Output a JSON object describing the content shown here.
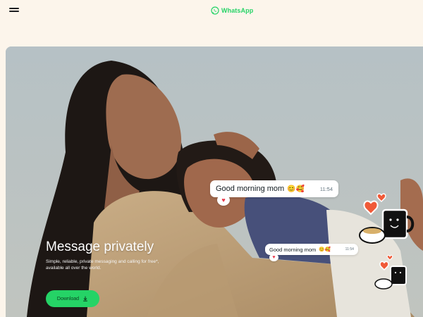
{
  "header": {
    "menu_icon": "hamburger-menu-icon",
    "logo_icon": "whatsapp-logo-icon",
    "logo_text": "WhatsApp"
  },
  "hero": {
    "headline": "Message privately",
    "subtext": "Simple, reliable, private messaging and calling for free*, available all over the world.",
    "download_label": "Download",
    "download_icon": "download-arrow-icon",
    "chat_bubble_1": {
      "text": "Good morning mom",
      "emoji": "😊🥰",
      "time": "11:54",
      "reaction": "♥"
    },
    "chat_bubble_2": {
      "text": "Good morning mom",
      "emoji": "😊🥰",
      "time": "11:54",
      "reaction": "♥"
    },
    "stickers": [
      "coffee-mugs-hearts-sticker",
      "coffee-mugs-hearts-sticker-small"
    ]
  },
  "colors": {
    "page_background": "#fcf5eb",
    "brand_green": "#25d366",
    "heart_red": "#e8374a"
  }
}
